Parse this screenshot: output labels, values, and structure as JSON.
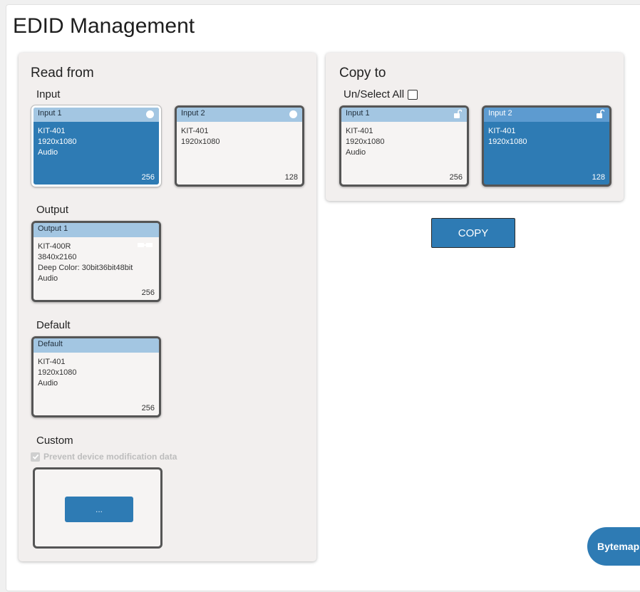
{
  "page": {
    "title": "EDID Management"
  },
  "read_from": {
    "title": "Read from",
    "input": {
      "title": "Input",
      "cards": [
        {
          "header": "Input 1",
          "lines": [
            "KIT-401",
            "1920x1080",
            "Audio"
          ],
          "count": "256",
          "selected": true,
          "icon": "dot-icon"
        },
        {
          "header": "Input 2",
          "lines": [
            "KIT-401",
            "1920x1080"
          ],
          "count": "128",
          "selected": false,
          "icon": "dot-icon"
        }
      ]
    },
    "output": {
      "title": "Output",
      "card": {
        "header": "Output 1",
        "lines": [
          "KIT-400R",
          "3840x2160",
          "Deep Color: 30bit36bit48bit",
          "Audio"
        ],
        "count": "256",
        "icon": "connector-icon"
      }
    },
    "default": {
      "title": "Default",
      "card": {
        "header": "Default",
        "lines": [
          "KIT-401",
          "1920x1080",
          "Audio"
        ],
        "count": "256"
      }
    },
    "custom": {
      "title": "Custom",
      "prevent_label": "Prevent device modification data",
      "prevent_checked": true,
      "browse_label": "..."
    }
  },
  "copy_to": {
    "title": "Copy to",
    "select_all_label": "Un/Select All",
    "select_all_checked": false,
    "cards": [
      {
        "header": "Input 1",
        "lines": [
          "KIT-401",
          "1920x1080",
          "Audio"
        ],
        "count": "256",
        "selected": false,
        "icon": "lock-open-icon"
      },
      {
        "header": "Input 2",
        "lines": [
          "KIT-401",
          "1920x1080"
        ],
        "count": "128",
        "selected": true,
        "icon": "lock-open-icon"
      }
    ],
    "copy_label": "COPY"
  },
  "bytemap_label": "Bytemap",
  "colors": {
    "accent": "#2e7bb4",
    "card_header": "#a3c6e2",
    "panel_bg": "#f2efee"
  }
}
